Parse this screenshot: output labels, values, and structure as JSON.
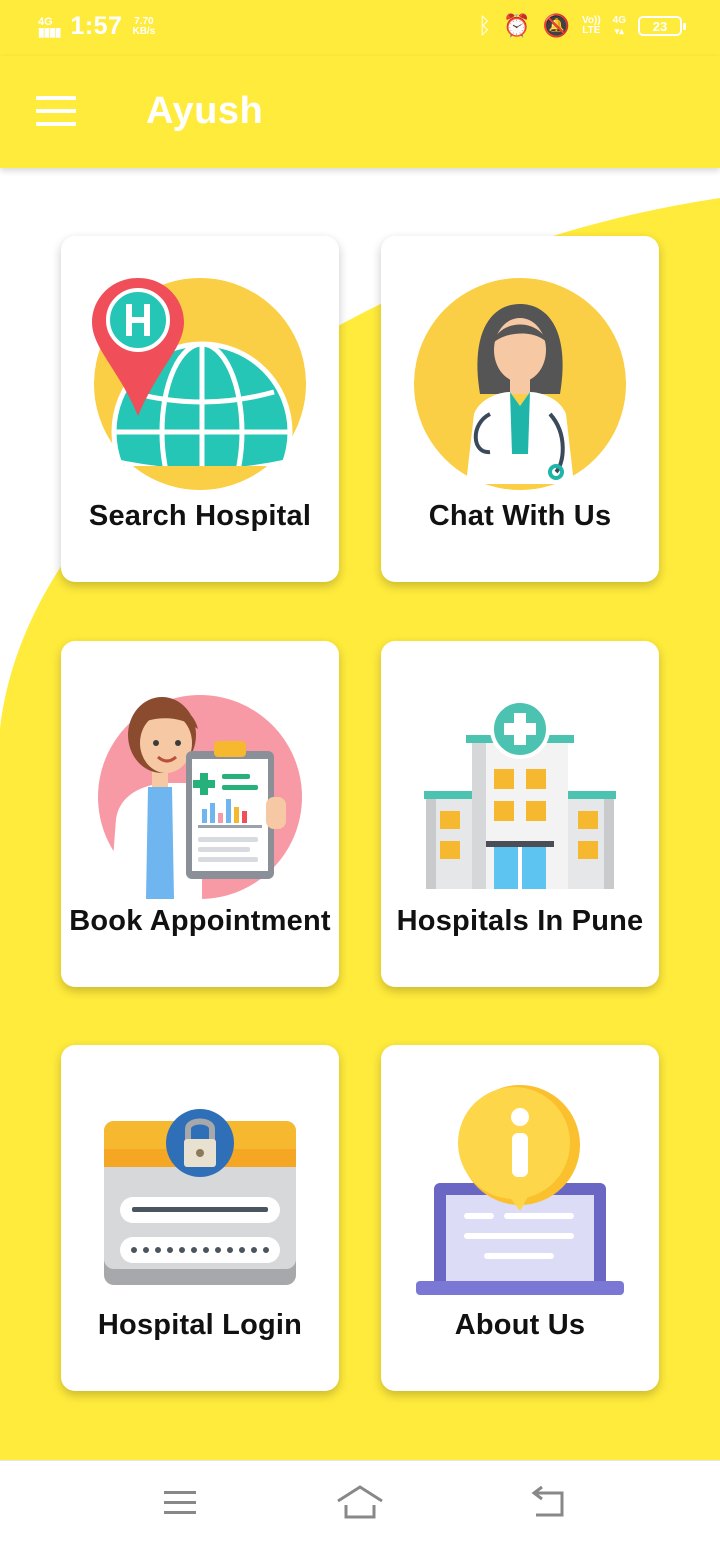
{
  "status_bar": {
    "network": "4G",
    "time": "1:57",
    "speed_value": "7.70",
    "speed_unit": "KB/s",
    "volte_top": "Vo))",
    "volte_bottom": "LTE",
    "network_right": "4G",
    "battery_level": "23"
  },
  "app_bar": {
    "title": "Ayush"
  },
  "cards": [
    {
      "label": "Search Hospital",
      "icon": "globe-hospital-pin-icon"
    },
    {
      "label": "Chat With Us",
      "icon": "female-doctor-icon"
    },
    {
      "label": "Book Appointment",
      "icon": "doctor-clipboard-icon"
    },
    {
      "label": "Hospitals In Pune",
      "icon": "hospital-building-icon"
    },
    {
      "label": "Hospital Login",
      "icon": "login-form-lock-icon"
    },
    {
      "label": "About Us",
      "icon": "info-laptop-icon"
    }
  ],
  "nav_bar": {
    "icons": [
      "menu-icon",
      "home-icon",
      "back-icon"
    ]
  },
  "colors": {
    "primary": "#ffeb3b",
    "background": "#ffffff",
    "card": "#ffffff",
    "text": "#111111"
  }
}
